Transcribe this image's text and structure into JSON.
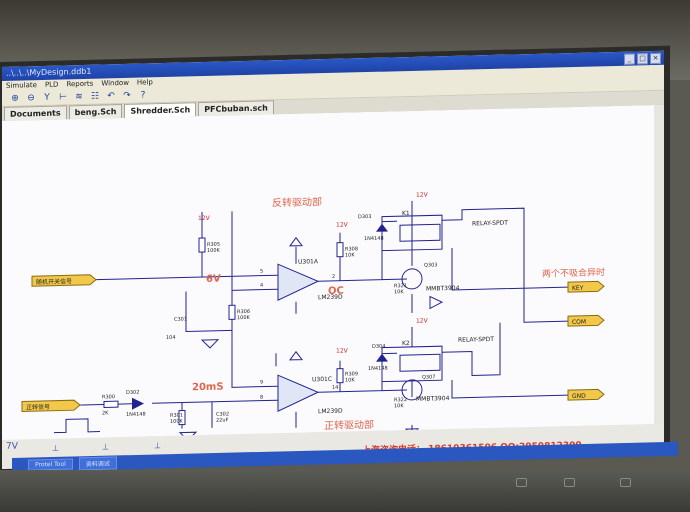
{
  "window": {
    "title": "..\\..\\..\\MyDesign.ddb1"
  },
  "menu": [
    "Simulate",
    "PLD",
    "Reports",
    "Window",
    "Help"
  ],
  "tabs": [
    "Documents",
    "beng.Sch",
    "Shredder.Sch",
    "PFCbuban.sch"
  ],
  "schematic": {
    "title_top": "反转驱动部",
    "title_bottom": "正转驱动部",
    "annotation_6v": "6V",
    "annotation_oc": "OC",
    "annotation_20ms": "20mS",
    "annotation_two_no_suck": "两个不吸合异时",
    "supply_12v": "12V",
    "net_input": "随机开关信号",
    "net_input2": "正转信号",
    "out_key": "KEY",
    "out_com": "COM",
    "out_gnd": "GND",
    "op_a": "U301A",
    "op_a_part": "LM239D",
    "op_c": "U301C",
    "op_c_part": "LM239D",
    "r_top1": "R305",
    "r_top1_val": "100K",
    "r_top2": "R306",
    "r_top2_val": "100K",
    "r_mid1": "R308",
    "r_mid1_val": "10K",
    "r_mid2": "R309",
    "r_mid2_val": "10K",
    "r_in": "R300",
    "r_in_val": "2K",
    "r_low1": "R301",
    "r_low1_val": "100K",
    "c_top": "C301",
    "c_top_val": "104",
    "c_low": "C302",
    "c_low_val": "22uF",
    "d_in": "D302",
    "d_in_val": "1N4148",
    "d_top": "D303",
    "d_top_val": "1N4148",
    "d_bot": "D304",
    "d_bot_val": "1N4148",
    "relay_k1": "K1",
    "relay_k2": "K2",
    "relay_k1_label": "RELAY-SPDT",
    "relay_k2_label": "RELAY-SPDT",
    "q_top": "Q303",
    "q_top_part": "MMBT3904",
    "q_bot": "Q307",
    "q_bot_part": "MMBT3904",
    "rb_top": "R321",
    "rb_top_val": "10K",
    "rb_bot": "R322",
    "rb_bot_val": "10K",
    "pin_2": "2",
    "pin_4": "4",
    "pin_5": "5",
    "pin_8": "8",
    "pin_9": "9",
    "pin_14": "14"
  },
  "status": {
    "left_value": "7V",
    "phone": "上海咨询电话： 18610361506  QQ:2959812300"
  },
  "taskbar": [
    "Protel Tool",
    "资料调试"
  ],
  "colors": {
    "title_red": "#e2644c",
    "wire_blue": "#22238f",
    "net_label": "#f2c84a",
    "taskbar": "#2a57c0"
  }
}
